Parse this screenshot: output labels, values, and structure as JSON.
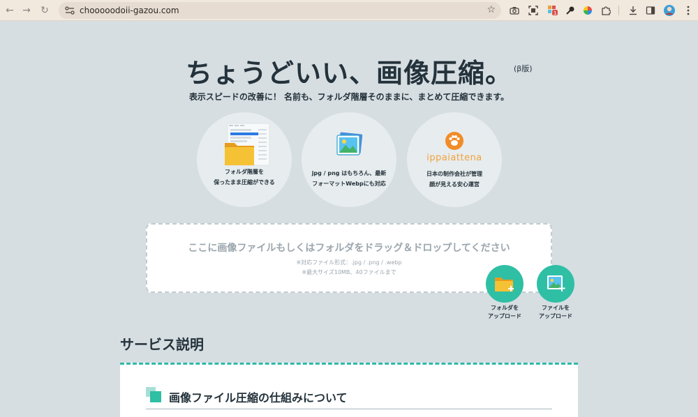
{
  "browser": {
    "url": "chooooodoii-gazou.com",
    "back_icon": "←",
    "forward_icon": "→",
    "reload_icon": "↻",
    "badge_count": "1"
  },
  "hero": {
    "title": "ちょうどいい、画像圧縮。",
    "beta": "(β版)",
    "subtitle": "表示スピードの改善に！ 名前も、フォルダ階層そのままに、まとめて圧縮できます。"
  },
  "features": [
    {
      "line1": "フォルダ階層を",
      "line2": "保ったまま圧縮ができる"
    },
    {
      "line1": "jpg / png はもちろん、最新",
      "line2": "フォーマットWebpにも対応"
    },
    {
      "line1": "日本の制作会社が管理",
      "line2": "顔が見える安心運営",
      "brand": "ippaiattena"
    }
  ],
  "dropzone": {
    "main": "ここに画像ファイルもしくはフォルダをドラッグ＆ドロップしてください",
    "note1": "※対応ファイル形式：.jpg / .png / .webp",
    "note2": "※最大サイズ10MB、40ファイルまで"
  },
  "upload": {
    "folder_line1": "フォルダを",
    "folder_line2": "アップロード",
    "file_line1": "ファイルを",
    "file_line2": "アップロード"
  },
  "section": {
    "heading": "サービス説明",
    "card_title": "画像ファイル圧縮の仕組みについて"
  },
  "colors": {
    "accent": "#2fbfa5",
    "background": "#d6dee2",
    "text": "#24323b"
  }
}
